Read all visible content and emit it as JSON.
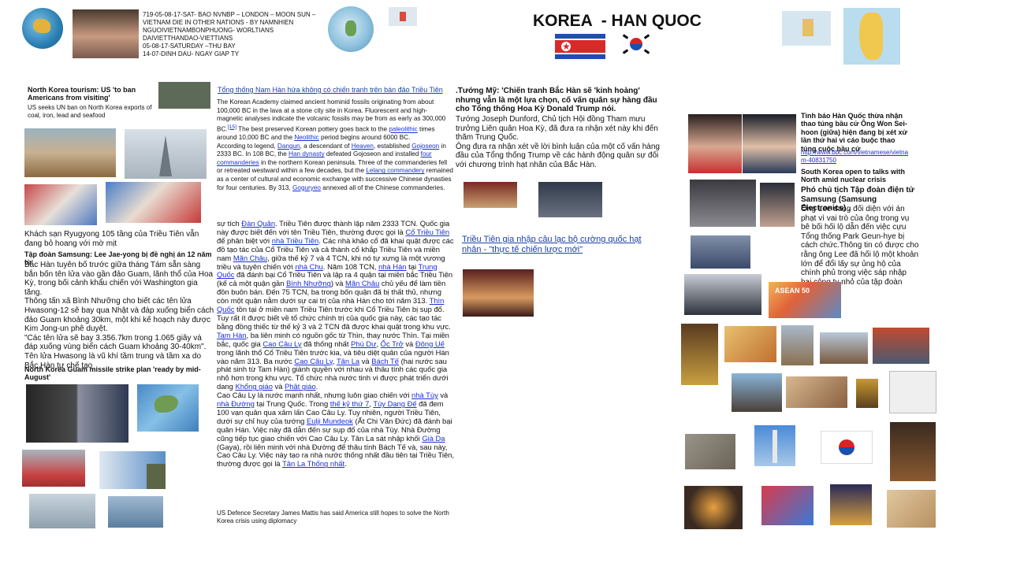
{
  "header": {
    "meta_lines": [
      "719-05-08-17-SAT- BAO NVNBP – LONDON – MOON SUN –",
      "VIETNAM DIE IN OTHER NATIONS  - BY NAMNHIEN",
      "NGUOIVIETNAMBONPHUONG- WORLTIANS",
      "DAIVIETTHANDAO-VIETTIANS",
      "05-08-17-SATURDAY –THU BAY",
      "14-07-DINH DAU- NGAY GIAP TY"
    ],
    "title": "KOREA  - HAN QUOC",
    "colors": {
      "nk_red": "#d92a2a",
      "nk_blue": "#1e4fb0",
      "sk_red": "#d22222",
      "sk_blue": "#1a4fae",
      "link": "#1a2fd6"
    }
  },
  "col1": {
    "nk_tourism_title": "North Korea tourism: US 'to ban Americans from visiting'",
    "nk_tourism_sub": "US seeks UN ban on North Korea exports of coal, iron, lead and seafood",
    "hotel_text": "Khách sạn Ryugyong 105 tầng của Triều Tiên vẫn đang bỏ hoang với mờ mịt",
    "samsung_title": "Tập đoàn Samsung: Lee Jae-yong bị đề nghị án 12 năm tù",
    "missile_para1": "Bắc Hàn tuyên bố trước giữa tháng Tám sẵn sàng bắn bốn tên lửa vào gần đảo Guam, lãnh thổ của Hoa Kỳ, trong bối cảnh khẩu chiến với Washington gia tăng.",
    "missile_para2": "Thông tấn xã Bình Nhưỡng cho biết các tên lửa Hwasong-12 sẽ bay qua Nhật và đáp xuống biển cách đảo Guam khoảng 30km, một khi kế hoạch này được Kim Jong-un phê duyệt.",
    "missile_para3": "\"Các tên lửa sẽ bay 3.356.7km trong 1.065 giây và đáp xuống vùng biển cách Guam khoảng 30-40km\".",
    "missile_para4": "Tên lửa Hwasong là vũ khí tầm trung và tầm xa do Bắc Hàn tự chế tạo",
    "guam_title": "North Korea Guam missile strike plan 'ready by mid-August'"
  },
  "col2": {
    "top_link": "Tổng thống Nam Hàn hứa không có chiến tranh trên bán đảo Triều Tiên",
    "en_p1": "The Korean Academy claimed ancient hominid fossils originating from about 100,000 BC in the lava at a stone city site in Korea. Fluorescent and high-magnetic analyses indicate the volcanic fossils may be from as early as 300,000 BC.",
    "en_p1_ref": "[15]",
    "en_p1b": " The best preserved Korean pottery goes back to the ",
    "en_paleolithic": "paleolithic",
    "en_p1c": " times around 10,000 BC and the ",
    "en_neolithic": "Neolithic",
    "en_p1d": " period begins around 6000 BC.",
    "en_p2a": "According to legend, ",
    "en_dangun": "Dangun",
    "en_p2b": ", a descendant of ",
    "en_heaven": "Heaven",
    "en_p2c": ", established ",
    "en_gojoseon": "Gojoseon",
    "en_p2d": " in 2333 BC. In 108 BC, the ",
    "en_han": "Han dynasty",
    "en_p2e": " defeated Gojoseon and installed ",
    "en_four": "four commanderies",
    "en_p2f": " in the northern Korean peninsula. Three of the commanderies fell or retreated westward within a few decades, but the ",
    "en_lelang": "Lelang commandery",
    "en_p2g": " remained as a center of cultural and economic exchange with successive Chinese dynasties for four centuries. By 313, ",
    "en_goguryeo": "Goguryeo",
    "en_p2h": " annexed all of the Chinese commanderies.",
    "vn_p1a": "sự tích ",
    "vn_danquan": "Đàn Quân",
    "vn_p1b": ". Triều Tiên được thành lập năm 2333 TCN. Quốc gia này được biết đến với tên Triều Tiên, thường được gọi là ",
    "vn_cotrieutien": "Cổ Triều Tiên",
    "vn_p1c": " để phân biệt với ",
    "vn_nhatrieutien": "nhà Triều Tiên",
    "vn_p1d": ". Các nhà khảo cổ đã khai quật được các đồ tạo tác của Cổ Triều Tiên và cả thành cổ khắp Triều Tiên và miền nam ",
    "vn_manchau": "Mãn Châu",
    "vn_p1e": ", giữa thế kỷ 7 và 4 TCN, khi nó tự xưng là một vương triều và tuyên chiến với ",
    "vn_nhachu": "nhà Chu",
    "vn_p1f": ". Năm 108 TCN, ",
    "vn_nhahan": "nhà Hán",
    "vn_p1g": " tại ",
    "vn_trungquoc": "Trung Quốc",
    "vn_p1h": " đã đánh bại Cổ Triều Tiên và lập ra 4 quận tại miền bắc Triều Tiên (kể cả một quận gần ",
    "vn_binhnhuong": "Bình Nhưỡng",
    "vn_p1i": ") và ",
    "vn_manchau2": "Mãn Châu",
    "vn_p1j": " chủ yếu để làm tiền đồn buôn bán. Đến 75 TCN, ba trong bốn quận đã bị thất thủ, nhưng còn một quận nằm dưới sự cai trị của nhà Hán cho tới năm 313.  ",
    "vn_thinquoc": "Thìn Quốc",
    "vn_p1k": " tồn tại ở miền nam Triều Tiên trước khi Cổ Triều Tiên bị sụp đổ. Tuy rất ít được biết về tổ chức chính trị của quốc gia này, các tạo tác bằng đồng thiếc từ thế kỷ 3 và 2 TCN đã được khai quật trong khu vực. ",
    "vn_tamhan": "Tam Hàn",
    "vn_p1l": ", ba liên minh có nguồn gốc từ Thìn, thay nước Thìn. Tại miền bắc, quốc gia ",
    "vn_caocauly": "Cao Câu Ly",
    "vn_p1m": " đã thống nhất ",
    "vn_phudu": "Phù Dư",
    "vn_p1n": ", ",
    "vn_octro": "Ốc Trở",
    "vn_p1o": " và ",
    "vn_dongue": "Đông Uế",
    "vn_p1p": " trong lãnh thổ Cổ Triều Tiên trước kia, và tiêu diệt quân của người Hán vào năm 313. Ba nước ",
    "vn_caocauly2": "Cao Câu Ly",
    "vn_p1q": ", ",
    "vn_tanla": "Tân La",
    "vn_p1r": " và ",
    "vn_bachte": "Bách Tế",
    "vn_p1s": " (hai nước sau phát sinh từ Tam Hàn) giành quyền với nhau và thâu tính các quốc gia nhỏ hơn trong khu vực. Tổ chức nhà nước tinh vi được phát triển dưới dang ",
    "vn_khonggiao": "Khổng giáo",
    "vn_p1t": " và ",
    "vn_phatgiao": "Phật giáo",
    "vn_p1u": ".",
    "vn_p2a": "Cao Câu Ly là nước mạnh nhất, nhưng luôn giao chiến với ",
    "vn_nhatuy": "nhà Tùy",
    "vn_p2b": " và ",
    "vn_nhaduong": "nhà Đường",
    "vn_p2c": " tại Trung Quốc. Trong ",
    "vn_thekythu7": "thế kỷ thứ 7",
    "vn_p2d": ", ",
    "vn_tuydangde": "Tùy Dạng Đế",
    "vn_p2e": " đã đem 100 vạn quân qua xâm lấn Cao Câu Ly. Tuy nhiên, người Triều Tiên, dưới sự chỉ huy của tướng ",
    "vn_eulji": "Eulji Mundeok",
    "vn_p2f": " (Ất Chi Văn Đức) đã đánh bại quân Hán. Việc này đã dẫn đến sự sụp đổ của nhà Tùy. Nhà Đường cũng tiếp tục giao chiến với Cao Câu Ly. Tân La sát nhập khối ",
    "vn_giada": "Già Da",
    "vn_p2g": " (Gaya), rồi liên minh với nhà Đường để thâu tính Bách Tế và, sau này, Cao Câu Ly. Việc này tạo ra nhà nước thống nhất đầu tiên tại Triều Tiên, thường được gọi là ",
    "vn_tanlathongnhat": "Tân La Thống nhất",
    "vn_p2h": ".",
    "us_defence": "US Defence Secretary James Mattis has said America still hopes to solve the North Korea crisis using diplomacy"
  },
  "col3": {
    "head_line1": ".Tướng Mỹ: 'Chiến tranh Bắc Hàn sẽ 'kinh hoàng'",
    "head_line2": "nhưng vẫn là một lựa chọn, cố vấn quân sự hàng đầu",
    "head_line3": "cho Tổng thống Hoa Kỳ Donald Trump nói.",
    "body1": "Tướng Joseph Dunford, Chủ tịch Hội đồng Tham mưu trưởng Liên quân Hoa Kỳ, đã đưa ra nhận xét này khi đến thăm Trung Quốc.",
    "body2": "Ông đưa ra nhận xét về lời bình luận của một cố vấn hàng đầu của Tổng thống Trump về các hành động quân sự đối với chương trình hạt nhân của Bắc Hàn.",
    "nk_link": "Triều Tiên gia nhập câu lạc bộ cường quốc hạt nhân - \"thực tế chiến lược mới\""
  },
  "col4": {
    "intel_title": "Tình báo Hàn Quốc thừa nhận thao túng bầu cử Ông Won Sei-hoon (giữa) hiện đang bị xét xử lần thứ hai vì cáo buộc thao túng cuộc bầu cử",
    "bbc_link": "http://www.bbc.com/vietnamese/vietnam-40831750",
    "sk_talks": "South Korea open to talks with North amid nuclear crisis",
    "samsung_vp": "Phó chủ tịch Tập đoàn điện tử Samsung (Samsung Electronics) .",
    "samsung_body": "Ông Lee đang đối diện với án phạt vì vai trò của ông trong vụ bê bối hối lộ dẫn đến việc cựu Tổng thống Park Geun-hye bị cách chức.Thông tin có được cho rằng ông Lee đã hối lộ một khoản lớn để đổi lấy sự ủng hộ của chính phủ trong việc sáp nhập hai công ty nhỏ của tập đoàn Samsung.",
    "asean_label": "ASEAN 50"
  },
  "icons": {
    "nk_flag": "north-korea-flag-icon",
    "sk_flag": "south-korea-flag-icon",
    "globe": "globe-icon",
    "map": "map-icon"
  }
}
